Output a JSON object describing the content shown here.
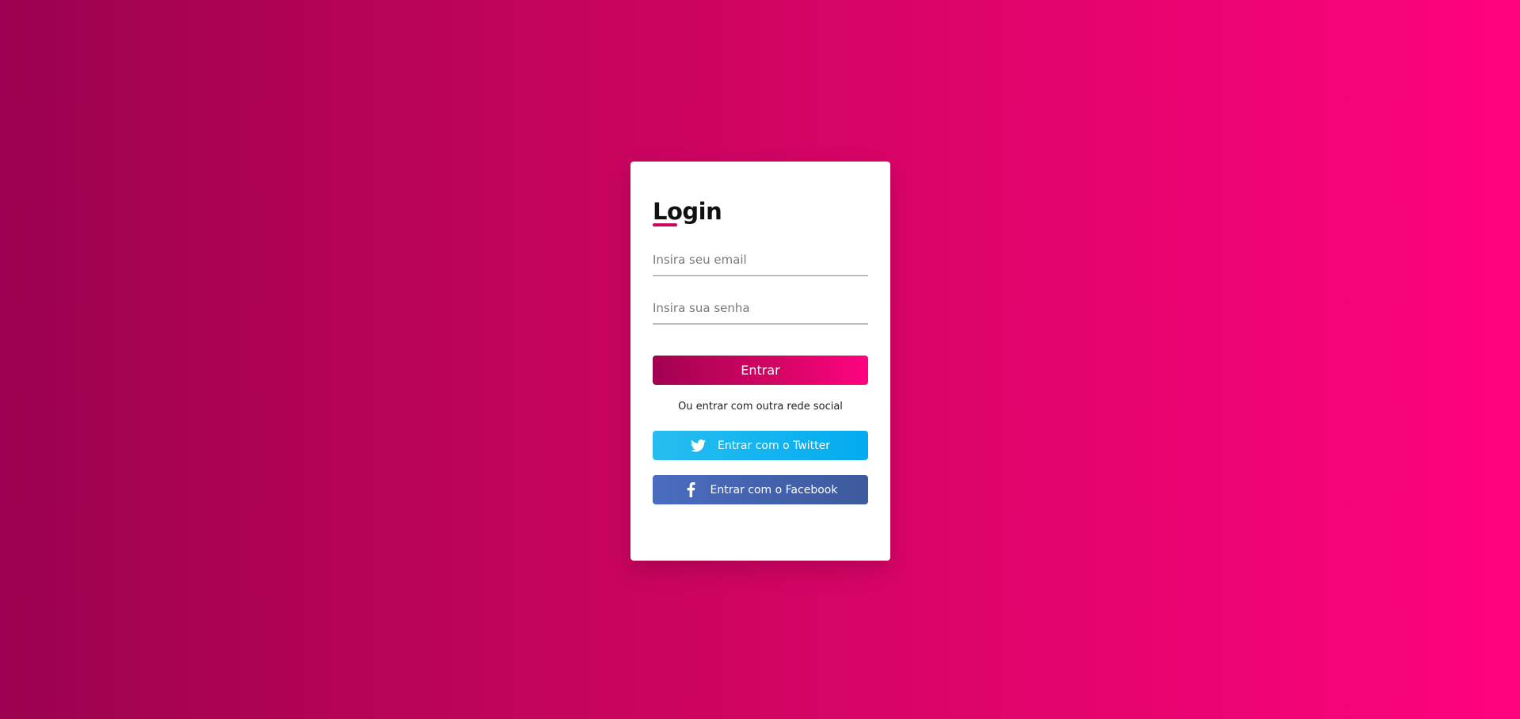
{
  "login": {
    "title": "Login",
    "email_placeholder": "Insira seu email",
    "password_placeholder": "Insira sua senha",
    "submit_label": "Entrar",
    "alt_text": "Ou entrar com outra rede social",
    "twitter_label": "Entrar com o Twitter",
    "facebook_label": "Entrar com o Facebook"
  },
  "icons": {
    "twitter": "twitter-icon",
    "facebook": "facebook-icon"
  },
  "colors": {
    "accent": "#c8065f",
    "twitter": "#1da1f2",
    "facebook": "#4267b2"
  }
}
